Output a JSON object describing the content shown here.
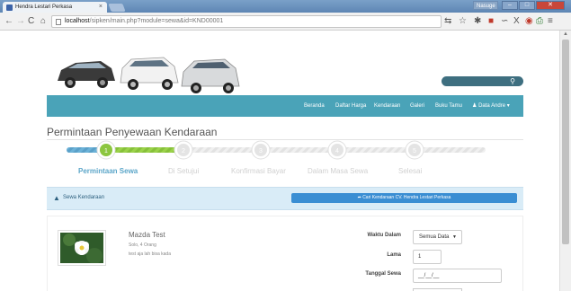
{
  "browser": {
    "tab_title": "Hendra Lestari Perkasa",
    "tab_close": "×",
    "user_badge": "Nasuge",
    "url_host": "localhost",
    "url_path": "/sipken/main.php?module=sewa&id=KND00001",
    "back_icon": "arrow-left",
    "forward_icon": "arrow-right",
    "reload_icon": "reload",
    "home_icon": "home"
  },
  "header": {
    "search_icon": "magnifier"
  },
  "nav": {
    "items": [
      "Beranda",
      "Daftar Harga",
      "Kendaraan",
      "Galeri",
      "Buku Tamu"
    ],
    "user": "Data Andre"
  },
  "page": {
    "title": "Permintaan Penyewaan Kendaraan"
  },
  "steps": {
    "numbers": [
      "1",
      "2",
      "3",
      "4",
      "5"
    ],
    "labels": [
      "Permintaan Sewa",
      "Di Setujui",
      "Konfirmasi Bayar",
      "Dalam Masa Sewa",
      "Selesai"
    ],
    "active_index": 0,
    "active_color": "#8cc63f",
    "label_active_color": "#5aa5c8"
  },
  "sewa_panel": {
    "title": "Sewa Kendaraan",
    "cari_button": "Cari Kendaraan CV. Hendra Lestari Perkasa"
  },
  "car": {
    "name": "Mazda Test",
    "sub": "Solo, 4 Orang",
    "desc": "test aja lah bisa kada"
  },
  "form": {
    "waktu_label": "Waktu Dalam",
    "waktu_value": "Semua Data",
    "lama_label": "Lama",
    "lama_value": "1",
    "tanggal_label": "Tanggal Sewa",
    "tanggal_value": "__/__/__"
  }
}
